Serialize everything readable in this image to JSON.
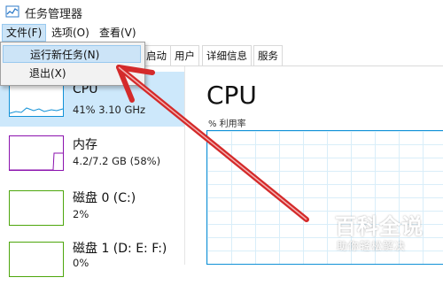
{
  "window": {
    "title": "任务管理器"
  },
  "menu": {
    "file": "文件(F)",
    "options": "选项(O)",
    "view": "查看(V)"
  },
  "file_menu": {
    "run_new_task": "运行新任务(N)",
    "exit": "退出(X)"
  },
  "tabs": [
    "启动",
    "用户",
    "详细信息",
    "服务"
  ],
  "performance": {
    "items": [
      {
        "name": "CPU",
        "detail": "41%  3.10 GHz"
      },
      {
        "name": "内存",
        "detail": "4.2/7.2 GB (58%)"
      },
      {
        "name": "磁盘 0 (C:)",
        "detail": "2%"
      },
      {
        "name": "磁盘 1 (D: E: F:)",
        "detail": "0%"
      }
    ],
    "main_title": "CPU",
    "util_label": "% 利用率"
  },
  "watermark": {
    "title": "百科全说",
    "subtitle": "助你轻松解决"
  },
  "colors": {
    "cpu": "#1191d7",
    "memory": "#8b12ae",
    "disk": "#4da60c",
    "arrow": "#d42a2a",
    "selection": "#cde8fb"
  }
}
